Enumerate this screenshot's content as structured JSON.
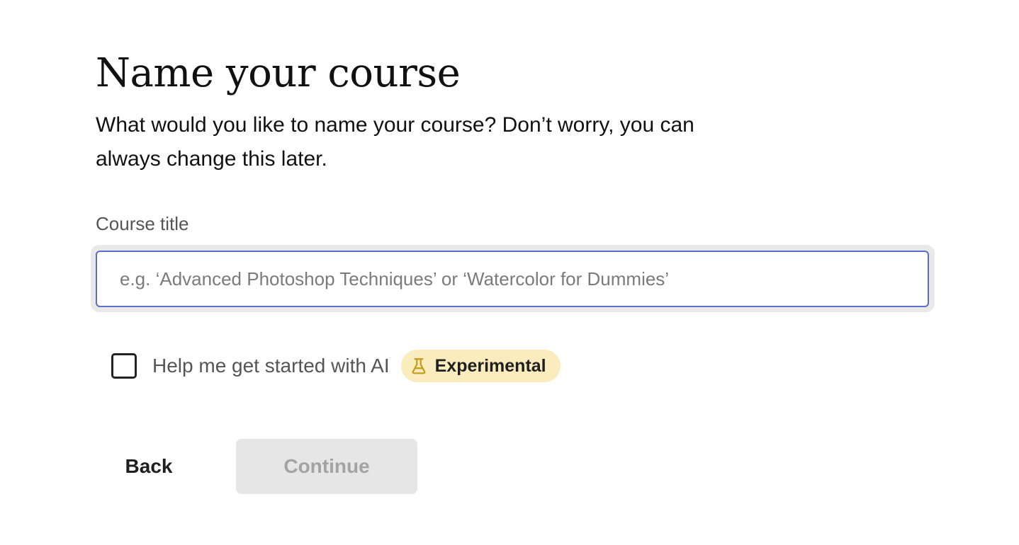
{
  "header": {
    "title": "Name your course",
    "subtitle": "What would you like to name your course? Don’t worry, you can always change this later."
  },
  "form": {
    "course_title_label": "Course title",
    "course_title_value": "",
    "course_title_placeholder": "e.g. ‘Advanced Photoshop Techniques’ or ‘Watercolor for Dummies’",
    "ai_checkbox_label": "Help me get started with AI",
    "ai_checkbox_checked": false,
    "badge_label": "Experimental",
    "badge_icon": "flask-icon"
  },
  "actions": {
    "back_label": "Back",
    "continue_label": "Continue",
    "continue_disabled": true
  },
  "colors": {
    "input_focus_border": "#5a6fc8",
    "badge_background": "#fbecbd",
    "badge_icon": "#c49a1a",
    "disabled_button_background": "#e6e6e6",
    "disabled_button_text": "#a3a3a3"
  }
}
